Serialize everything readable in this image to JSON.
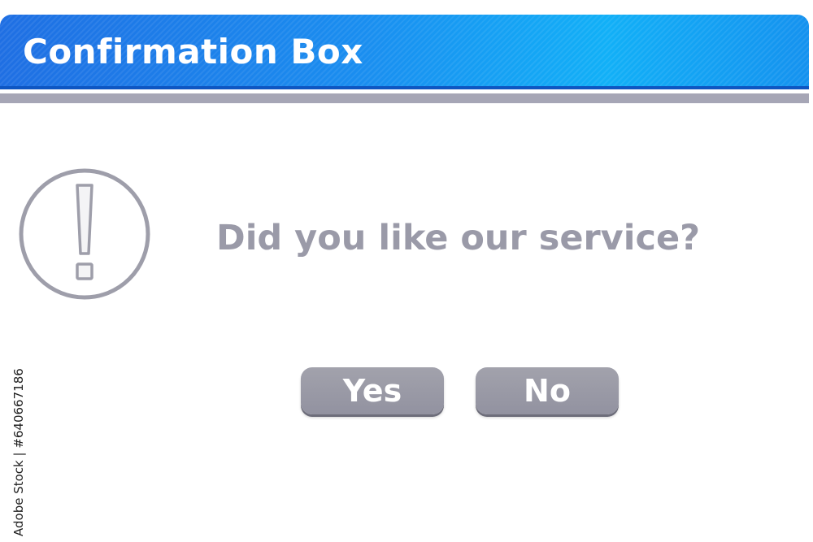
{
  "dialog": {
    "title": "Confirmation Box",
    "message": "Did you like our service?",
    "icon": "exclamation-circle-icon",
    "yes_label": "Yes",
    "no_label": "No"
  },
  "watermark": {
    "side_text": "Adobe Stock | #640667186"
  },
  "colors": {
    "titlebar_start": "#1f6fe3",
    "titlebar_end": "#12b0f7",
    "divider": "#a6a6b6",
    "text_gray": "#9a9aa8",
    "button_gray": "#9a9aa6"
  }
}
